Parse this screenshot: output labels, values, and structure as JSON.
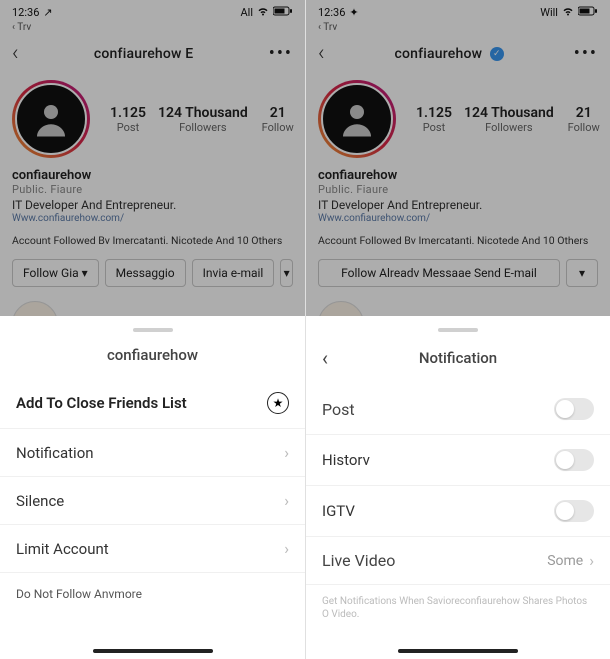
{
  "left": {
    "status": {
      "time": "12:36",
      "timeIcon": "↗",
      "carrier": "Trv",
      "right": "All",
      "sub": "Trv"
    },
    "header": {
      "username": "confiaurehow E",
      "verified": false
    },
    "stats": {
      "posts": {
        "num": "1.125",
        "label": "Post"
      },
      "followers": {
        "num": "124 Thousand",
        "label": "Followers"
      },
      "following": {
        "num": "21",
        "label": "Follow"
      }
    },
    "bio": {
      "name": "confiaurehow",
      "category": "Public. Fiaure",
      "desc": "IT Developer And Entrepreneur.",
      "link": "Www.confiaurehow.com/"
    },
    "followedBy": "Account Followed Bv Imercatanti. Nicotede And 10 Others",
    "actions": {
      "follow": "Follow Gia ▾",
      "message": "Messaggio",
      "email": "Invia e-mail",
      "more": "▾"
    },
    "sheet": {
      "title": "confiaurehow",
      "addClose": "Add To Close Friends List",
      "notification": "Notification",
      "silence": "Silence",
      "limit": "Limit Account",
      "unfollow": "Do Not Follow Anvmore"
    }
  },
  "right": {
    "status": {
      "time": "12:36",
      "timeIcon": "✦",
      "carrier": "Trv",
      "right": "Will",
      "sub": "Trv"
    },
    "header": {
      "username": "confiaurehow",
      "verified": true
    },
    "stats": {
      "posts": {
        "num": "1.125",
        "label": "Post"
      },
      "followers": {
        "num": "124 Thousand",
        "label": "Followers"
      },
      "following": {
        "num": "21",
        "label": "Follow"
      }
    },
    "bio": {
      "name": "confiaurehow",
      "category": "Public. Fiaure",
      "desc": "IT Developer And Entrepreneur.",
      "link": "Www.confiaurehow.com/"
    },
    "followedBy": "Account Followed Bv Imercatanti. Nicotede And 10 Others",
    "actions": {
      "combo": "Follow Alreadv Messaae Send E-mail",
      "more": "▾"
    },
    "sheet": {
      "title": "Notification",
      "post": "Post",
      "history": "Historv",
      "igtv": "IGTV",
      "live": "Live Video",
      "liveValue": "Some",
      "note": "Get Notifications When Savioreconfiaurehow Shares Photos O Video."
    }
  }
}
